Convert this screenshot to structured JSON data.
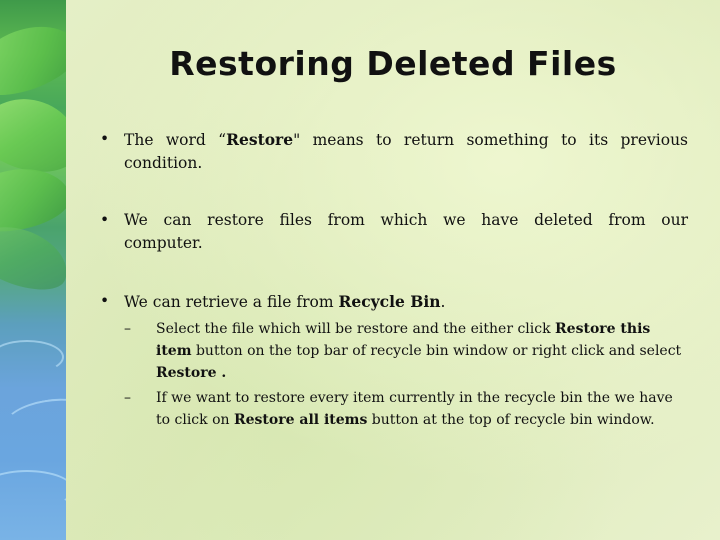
{
  "slide": {
    "title": "Restoring Deleted Files",
    "bullets": [
      {
        "marker": "•",
        "parts": [
          "The word “",
          "Restore",
          "\" means to  return  something  to  its  previous condition."
        ]
      },
      {
        "marker": "•",
        "text": "We can restore files from which we have deleted from our computer."
      },
      {
        "marker": "•",
        "parts": [
          "We can retrieve a file from ",
          "Recycle Bin",
          "."
        ]
      }
    ],
    "sub_bullets": [
      {
        "marker": "–",
        "parts": [
          "Select the file which will be restore and the either click ",
          "Restore this item",
          " button on the top bar of recycle bin window or right click and select ",
          "Restore .",
          ""
        ]
      },
      {
        "marker": "–",
        "parts": [
          "If  we want to restore every item currently in the recycle bin the we have to click on ",
          "Restore all items",
          " button at the top of recycle bin window."
        ]
      }
    ]
  }
}
